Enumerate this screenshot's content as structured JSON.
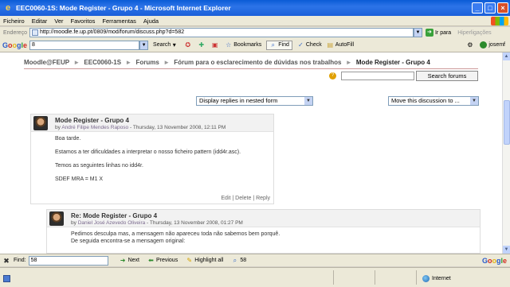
{
  "window": {
    "title": "EEC0060-1S: Mode Register - Grupo 4 - Microsoft Internet Explorer"
  },
  "menubar": {
    "items": [
      "Ficheiro",
      "Editar",
      "Ver",
      "Favoritos",
      "Ferramentas",
      "Ajuda"
    ]
  },
  "addressbar": {
    "label": "Endereço",
    "url": "http://moodle.fe.up.pt/0809/mod/forum/discuss.php?d=582",
    "go_label": "Ir para",
    "links_label": "Hiperligações"
  },
  "googlebar": {
    "logo": [
      "G",
      "o",
      "o",
      "g",
      "l",
      "e"
    ],
    "query": "8",
    "search_label": "Search",
    "bookmarks_label": "Bookmarks",
    "find_label": "Find",
    "check_label": "Check",
    "autofill_label": "AutoFill",
    "user": "josemf"
  },
  "breadcrumb": {
    "home": "Moodle@FEUP",
    "course": "EEC0060-1S",
    "forums": "Forums",
    "forum": "Fórum para o esclarecimento de dúvidas nos trabalhos",
    "current": "Mode Register - Grupo 4"
  },
  "search": {
    "button_label": "Search forums"
  },
  "controls": {
    "display_mode": "Display replies in nested form",
    "move_discussion": "Move this discussion to ..."
  },
  "posts": [
    {
      "subject": "Mode Register - Grupo 4",
      "by": "by",
      "author": "André Filipe Mendes Raposo",
      "date": "- Thursday, 13 November 2008, 12:11 PM",
      "body": [
        "Boa tarde.",
        "Estamos a ter dificuldades a interpretar o nosso ficheiro pattern (idd4r.asc).",
        "Temos as seguintes linhas no idd4r.",
        "SDEF MRA = M1 X"
      ],
      "commands": "Edit | Delete | Reply"
    },
    {
      "subject": "Re: Mode Register - Grupo 4",
      "by": "by",
      "author": "Daniel José Azevedo Oliveira",
      "date": "- Thursday, 13 November 2008, 01:27 PM",
      "body": [
        "Pedimos desculpa mas, a mensagem não apareceu toda não sabemos bem porquê.",
        "De seguida encontra-se a mensagem original:"
      ]
    }
  ],
  "findbar": {
    "label": "Find:",
    "query": "58",
    "next_label": "Next",
    "previous_label": "Previous",
    "highlight_label": "Highlight all",
    "matches": "58",
    "google": "Google"
  },
  "statusbar": {
    "zone": "Internet"
  }
}
